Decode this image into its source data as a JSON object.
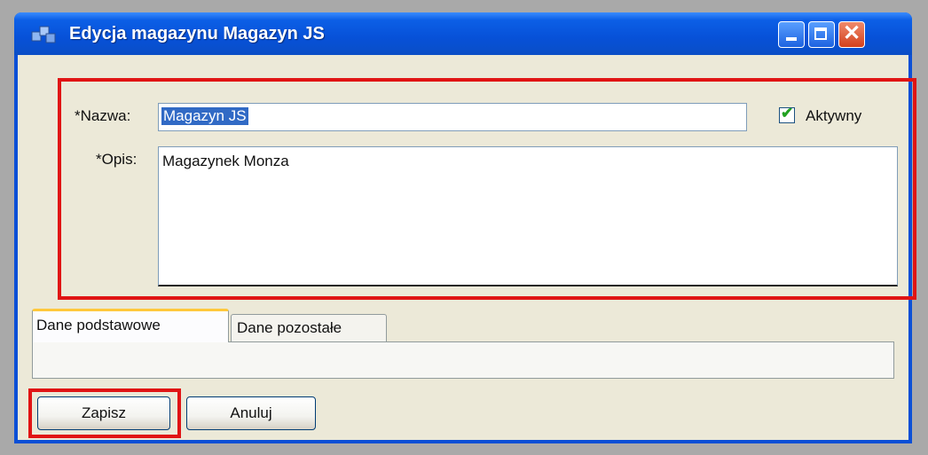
{
  "window": {
    "title": "Edycja magazynu Magazyn JS",
    "title_icon": "app-cubes-icon",
    "controls": {
      "minimize": "minimize-icon",
      "maximize": "maximize-icon",
      "close": "close-icon"
    }
  },
  "form": {
    "name_label": "*Nazwa:",
    "name_value": "Magazyn JS",
    "active_label": "Aktywny",
    "active_checked": true,
    "description_label": "*Opis:",
    "description_value": "Magazynek Monza"
  },
  "tabs": [
    {
      "label": "Dane podstawowe",
      "active": true
    },
    {
      "label": "Dane pozostałe",
      "active": false
    }
  ],
  "buttons": {
    "save_label": "Zapisz",
    "cancel_label": "Anuluj"
  },
  "colors": {
    "titlebar": "#0751d8",
    "highlight": "#e01414",
    "active_tab_accent": "#ffc83c",
    "selection": "#316ac5"
  }
}
